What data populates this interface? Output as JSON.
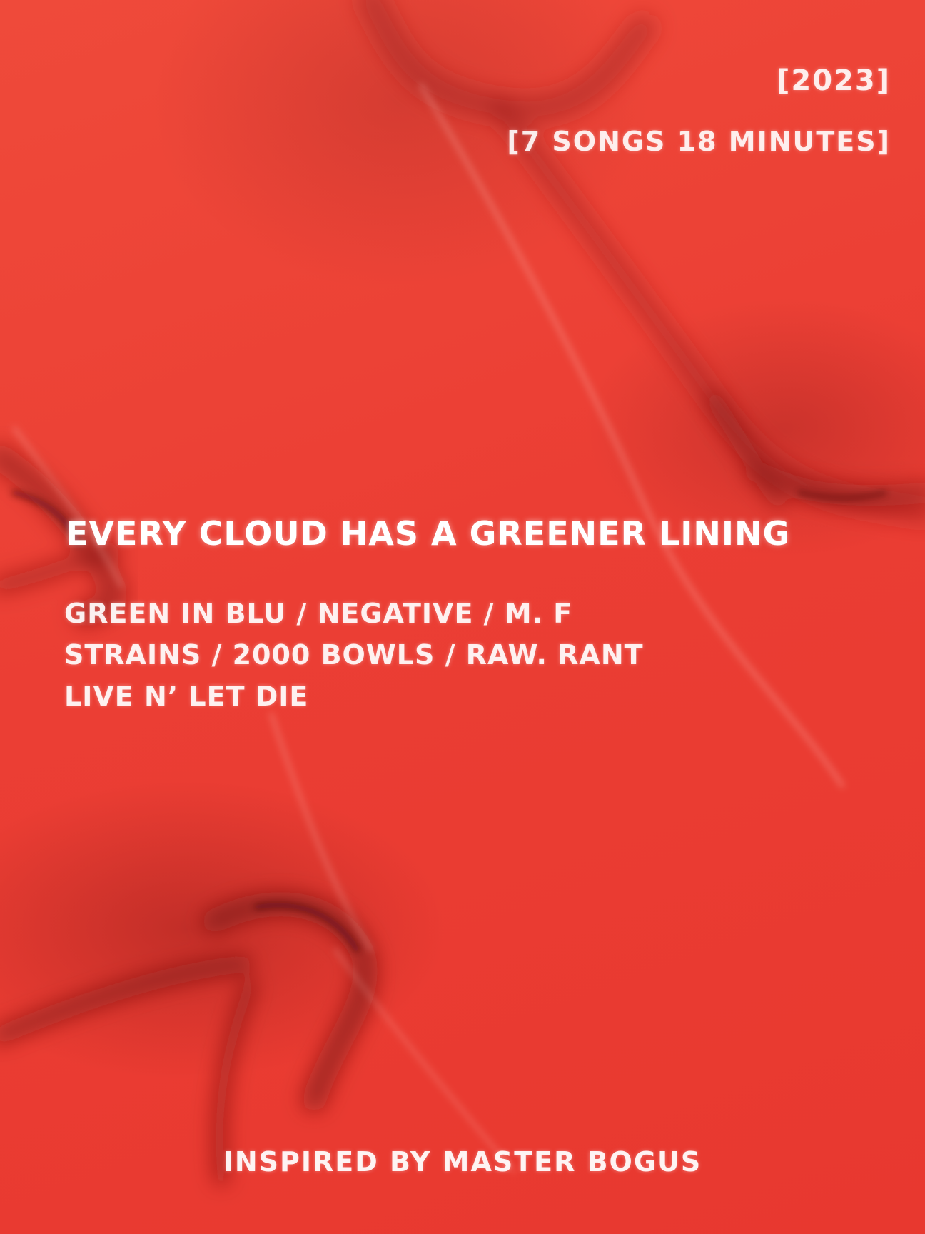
{
  "colors": {
    "background": "#ea3a34",
    "text": "#ffffff",
    "shadow": "#7a1414"
  },
  "meta": {
    "year": "[2023]",
    "stats": "[7 SONGS 18 MINUTES]"
  },
  "album": {
    "title": "EVERY CLOUD HAS A GREENER LINING"
  },
  "tracklist": {
    "lines": [
      "GREEN IN BLU / NEGATIVE / M. F",
      "STRAINS / 2000 BOWLS / RAW. RANT",
      "LIVE N’ LET DIE"
    ]
  },
  "footer": {
    "credit": "INSPIRED BY MASTER BOGUS"
  }
}
